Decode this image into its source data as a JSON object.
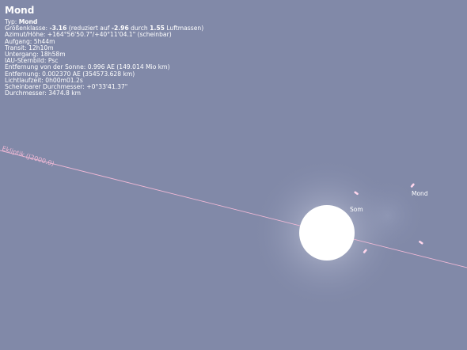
{
  "object": {
    "name": "Mond",
    "type_label": "Typ: ",
    "type_value": "Mond",
    "magnitude_label": "Größenklasse: ",
    "magnitude_value": "-3.16",
    "magnitude_reduced_text": " (reduziert auf ",
    "magnitude_reduced_value": "-2.96",
    "magnitude_by_text": " durch ",
    "airmass_value": "1.55",
    "airmass_label": " Luftmassen)",
    "azimuth": "Azimut/Höhe: +164°56'50.7\"/+40°11'04.1\" (scheinbar)",
    "rise": "Aufgang: 5h44m",
    "transit": "Transit: 12h10m",
    "set": "Untergang: 18h58m",
    "constellation": "IAU-Sternbild: Psc",
    "sun_distance": "Entfernung von der Sonne: 0.996 AE (149.014 Mio km)",
    "distance": "Entfernung: 0.002370 AE (354573.628 km)",
    "light_time": "Lichtlaufzeit: 0h00m01.2s",
    "apparent_diameter": "Scheinbarer Durchmesser: +0°33'41.37\"",
    "diameter": "Durchmesser: 3474.8 km"
  },
  "sky": {
    "ecliptic_label": "Ekliptik (J2000.0)",
    "sun_label": "Som",
    "moon_label": "Mond",
    "colors": {
      "background": "#8189a8",
      "ecliptic": "#f1b9d6",
      "sun": "#ffffff",
      "marker": "#ffd6ec"
    }
  }
}
